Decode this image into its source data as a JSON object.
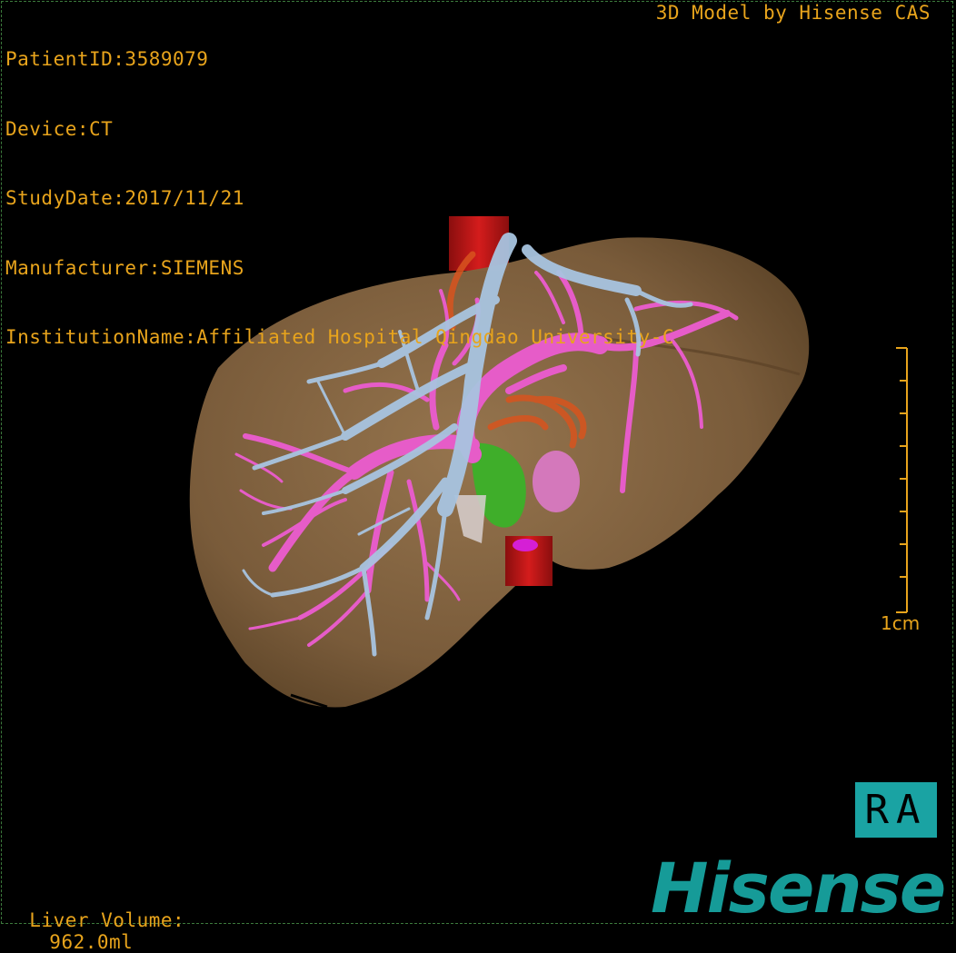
{
  "header": {
    "patient_id": "PatientID:3589079",
    "device": "Device:CT",
    "study_date": "StudyDate:2017/11/21",
    "manufacturer": "Manufacturer:SIEMENS",
    "institution": "InstitutionName:Affiliated Hospital Qingdao University-C"
  },
  "credit": "3D Model by Hisense CAS",
  "measurements": {
    "liver_volume_label": "Liver Volume:",
    "liver_volume_value": "962.0ml"
  },
  "scale_bar": {
    "label": "1cm",
    "ticks": 9
  },
  "orientation": "RA",
  "logo_text": "Hisense",
  "colors": {
    "overlay_text": "#e8a41c",
    "liver": "#8a6a44",
    "hepatic_vein": "#a8c4e0",
    "portal_vein": "#e65cc8",
    "artery": "#c41414",
    "gallbladder": "#3fae2a",
    "logo": "#169b98"
  }
}
